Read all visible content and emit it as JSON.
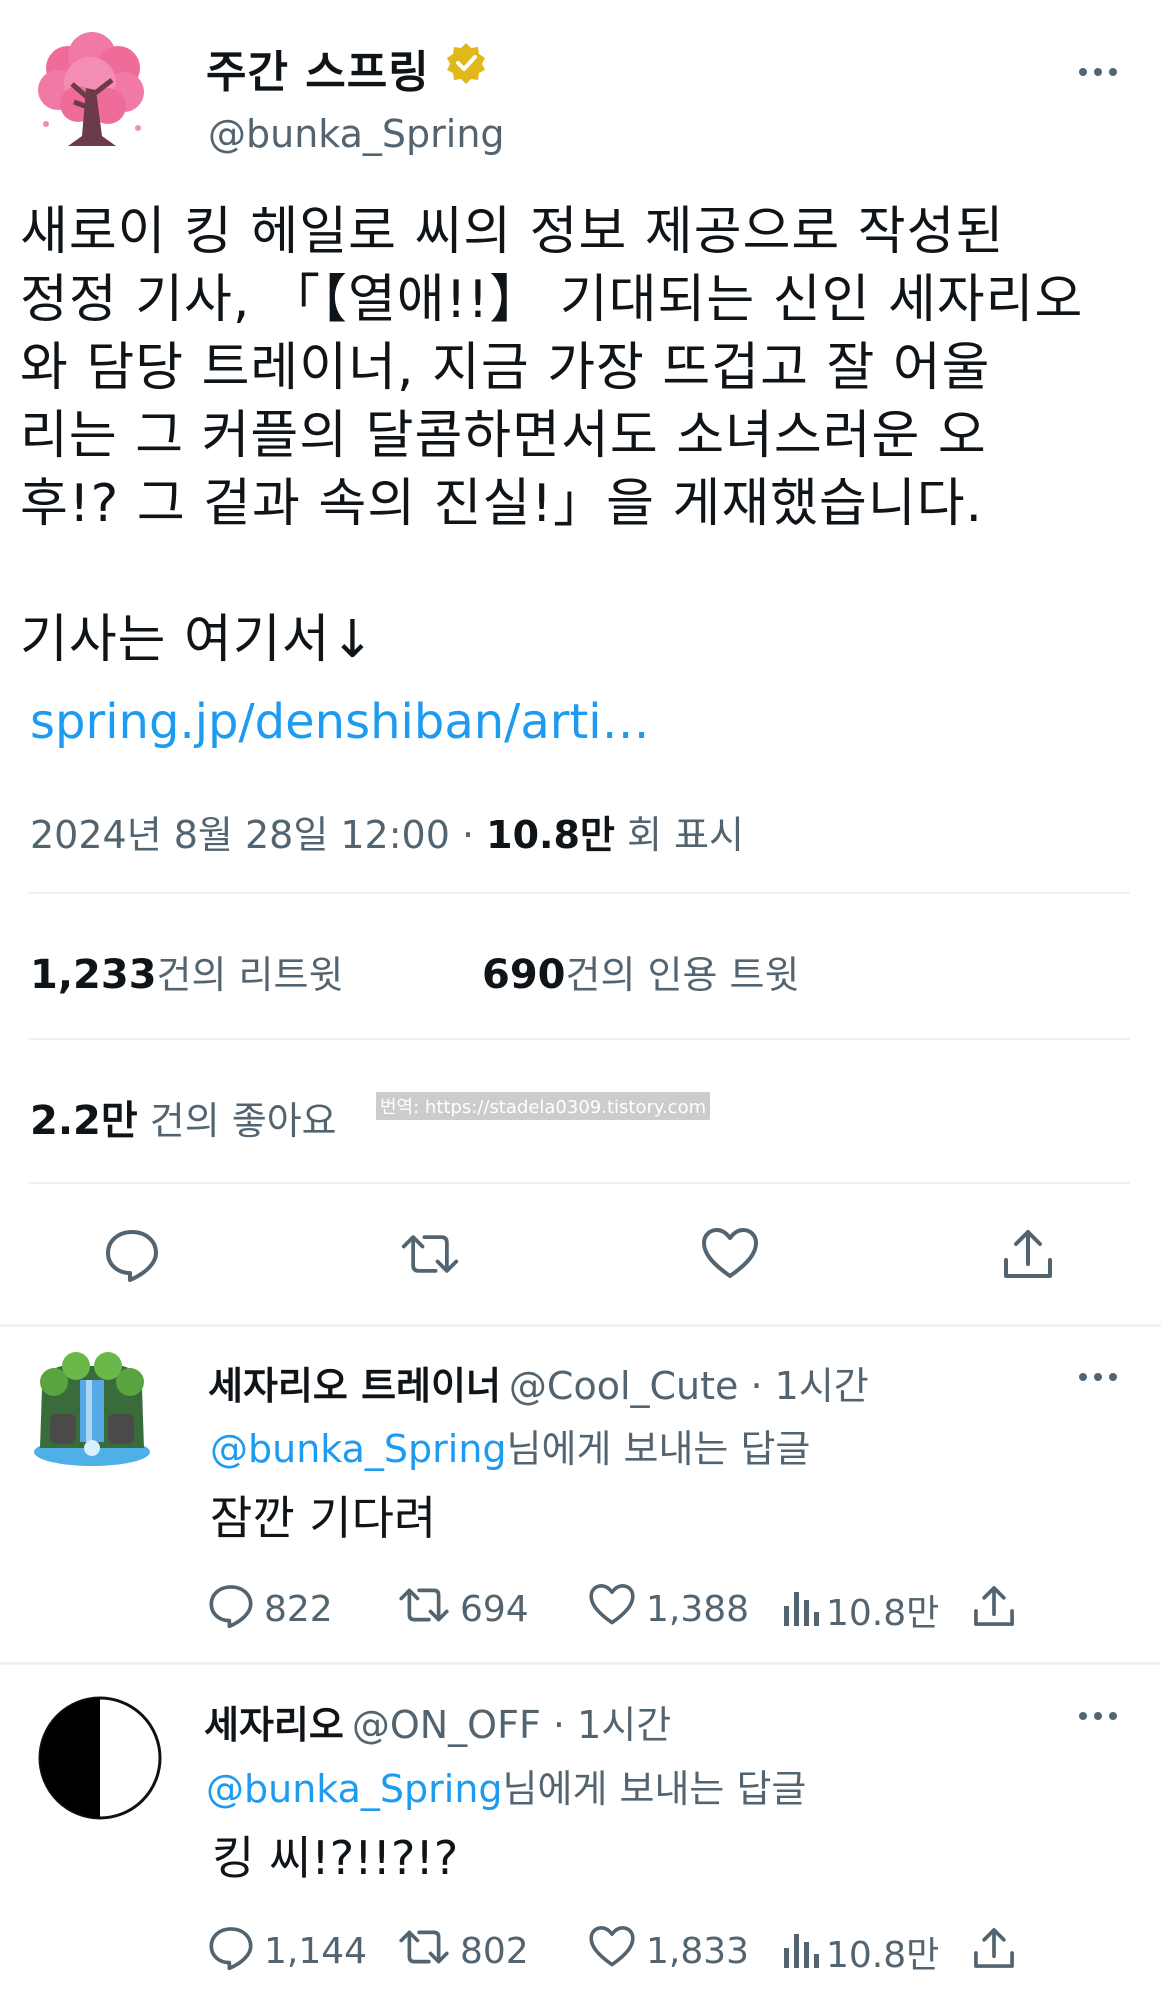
{
  "tweet": {
    "display_name": "주간 스프링",
    "handle": "@bunka_Spring",
    "body": "새로이 킹 헤일로 씨의 정보 제공으로 작성된\n정정 기사, 「【열애!!】 기대되는 신인 세자리오\n와 담당 트레이너, 지금 가장 뜨겁고 잘 어울\n리는 그 커플의 달콤하면서도 소녀스러운 오\n후!? 그 겉과 속의 진실!」을 게재했습니다.\n\n기사는 여기서↓",
    "link": "spring.jp/denshiban/arti…",
    "date": "2024년 8월 28일  12:00",
    "separator": "·",
    "views": "10.8만",
    "views_suffix": "회 표시",
    "retweets": "1,233",
    "retweets_label": "건의 리트윗",
    "quotes": "690",
    "quotes_label": "건의 인용 트윗",
    "likes": "2.2만",
    "likes_label": "건의 좋아요",
    "watermark": "번역: https://stadela0309.tistory.com"
  },
  "replies": [
    {
      "name": "세자리오 트레이너",
      "handle": "@Cool_Cute",
      "time": "· 1시간",
      "mention": "@bunka_Spring",
      "reply_suffix": "님에게 보내는 답글",
      "text": "잠깐 기다려",
      "comments": "822",
      "retweets": "694",
      "likes": "1,388",
      "views": "10.8만"
    },
    {
      "name": "세자리오",
      "handle": "@ON_OFF",
      "time": "· 1시간",
      "mention": "@bunka_Spring",
      "reply_suffix": "님에게 보내는 답글",
      "text": "킹 씨!?!!?!?",
      "comments": "1,144",
      "retweets": "802",
      "likes": "1,833",
      "views": "10.8만"
    }
  ],
  "colors": {
    "accent": "#1d9bf0",
    "verified_badge": "#e2b719",
    "secondary_text": "#536471"
  },
  "icons": [
    "more-icon",
    "verified-badge-icon",
    "reply-icon",
    "retweet-icon",
    "like-icon",
    "share-icon",
    "views-icon"
  ]
}
